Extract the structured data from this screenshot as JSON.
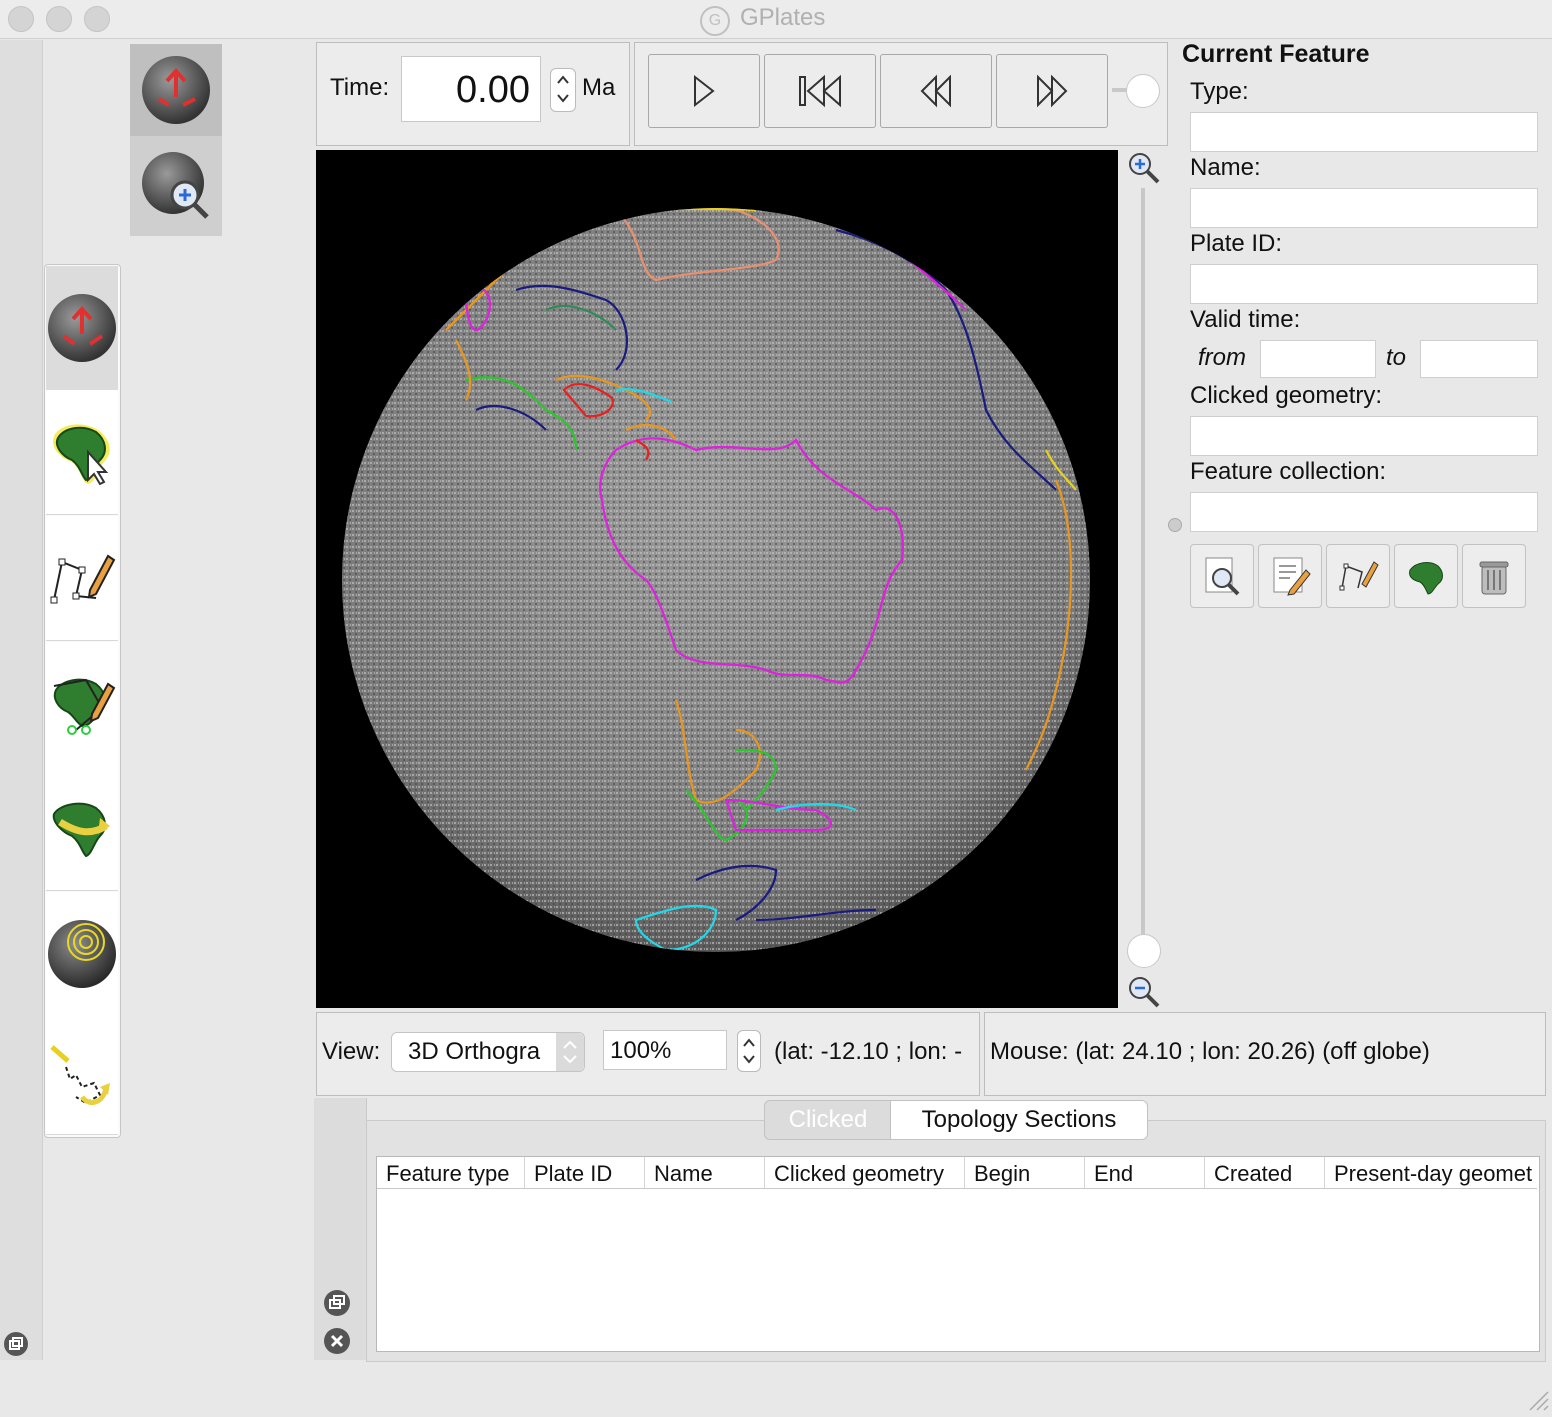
{
  "window": {
    "title": "GPlates"
  },
  "time_control": {
    "time_label": "Time:",
    "time_value": "0.00",
    "time_unit": "Ma",
    "buttons": [
      "play-icon",
      "skip-to-start-icon",
      "step-back-icon",
      "step-forward-icon"
    ]
  },
  "globe_tools": [
    "drag-globe-icon",
    "zoom-globe-icon"
  ],
  "toolbox_tools": [
    "drag-globe-icon",
    "choose-feature-icon",
    "digitise-geometry-icon",
    "edit-feature-geometry-icon",
    "move-pole-icon",
    "small-circle-icon",
    "build-topology-icon"
  ],
  "view_bar": {
    "view_label": "View:",
    "projection_value": "3D Orthogra",
    "zoom_value": "100%",
    "camera_coords": "(lat: -12.10 ; lon: -",
    "mouse_coords": "Mouse: (lat: 24.10 ; lon: 20.26) (off globe)"
  },
  "current_feature": {
    "heading": "Current Feature",
    "type_label": "Type:",
    "name_label": "Name:",
    "plate_id_label": "Plate ID:",
    "valid_time_label": "Valid time:",
    "from_label": "from",
    "to_label": "to",
    "clicked_geometry_label": "Clicked geometry:",
    "feature_collection_label": "Feature collection:",
    "action_icons": [
      "query-feature-icon",
      "edit-feature-icon",
      "digitise-icon",
      "plate-feature-icon",
      "delete-feature-icon"
    ]
  },
  "bottom_panel": {
    "tabs": [
      "Clicked",
      "Topology Sections"
    ],
    "columns": [
      "Feature type",
      "Plate ID",
      "Name",
      "Clicked geometry",
      "Begin",
      "End",
      "Created",
      "Present-day geomet"
    ]
  },
  "colors": {
    "globe_background": "#000000",
    "feature_magenta": "#e020e0",
    "feature_orange": "#e8961e",
    "feature_green": "#28c828",
    "feature_navy": "#1a1a80",
    "feature_cyan": "#20d8e8",
    "feature_red": "#e82020",
    "feature_yellow": "#e8d020",
    "feature_salmon": "#e89070"
  }
}
